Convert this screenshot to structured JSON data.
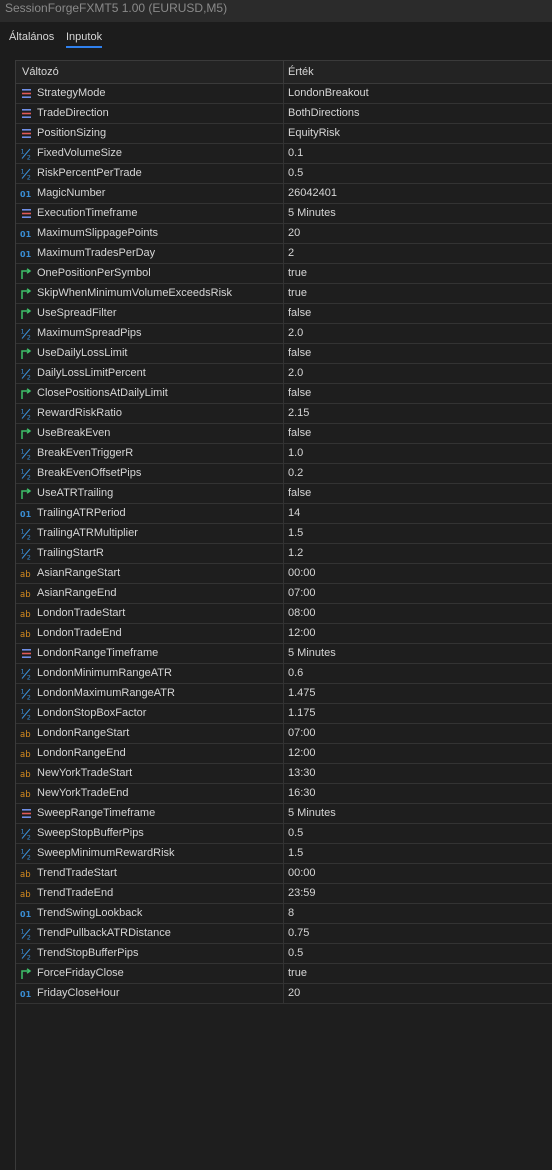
{
  "window": {
    "title": "SessionForgeFXMT5 1.00 (EURUSD,M5)"
  },
  "tabs": [
    {
      "label": "Általános"
    },
    {
      "label": "Inputok"
    }
  ],
  "table": {
    "headers": {
      "variable": "Változó",
      "value": "Érték"
    },
    "rows": [
      {
        "type": "enum",
        "icon": "enum-icon",
        "name": "StrategyMode",
        "value": "LondonBreakout"
      },
      {
        "type": "enum",
        "icon": "enum-icon",
        "name": "TradeDirection",
        "value": "BothDirections"
      },
      {
        "type": "enum",
        "icon": "enum-icon",
        "name": "PositionSizing",
        "value": "EquityRisk"
      },
      {
        "type": "double",
        "icon": "double-icon",
        "name": "FixedVolumeSize",
        "value": "0.1"
      },
      {
        "type": "double",
        "icon": "double-icon",
        "name": "RiskPercentPerTrade",
        "value": "0.5"
      },
      {
        "type": "int",
        "icon": "integer-icon",
        "name": "MagicNumber",
        "value": "26042401"
      },
      {
        "type": "enum",
        "icon": "enum-icon",
        "name": "ExecutionTimeframe",
        "value": "5 Minutes"
      },
      {
        "type": "int",
        "icon": "integer-icon",
        "name": "MaximumSlippagePoints",
        "value": "20"
      },
      {
        "type": "int",
        "icon": "integer-icon",
        "name": "MaximumTradesPerDay",
        "value": "2"
      },
      {
        "type": "bool",
        "icon": "bool-icon",
        "name": "OnePositionPerSymbol",
        "value": "true"
      },
      {
        "type": "bool",
        "icon": "bool-icon",
        "name": "SkipWhenMinimumVolumeExceedsRisk",
        "value": "true"
      },
      {
        "type": "bool",
        "icon": "bool-icon",
        "name": "UseSpreadFilter",
        "value": "false"
      },
      {
        "type": "double",
        "icon": "double-icon",
        "name": "MaximumSpreadPips",
        "value": "2.0"
      },
      {
        "type": "bool",
        "icon": "bool-icon",
        "name": "UseDailyLossLimit",
        "value": "false"
      },
      {
        "type": "double",
        "icon": "double-icon",
        "name": "DailyLossLimitPercent",
        "value": "2.0"
      },
      {
        "type": "bool",
        "icon": "bool-icon",
        "name": "ClosePositionsAtDailyLimit",
        "value": "false"
      },
      {
        "type": "double",
        "icon": "double-icon",
        "name": "RewardRiskRatio",
        "value": "2.15"
      },
      {
        "type": "bool",
        "icon": "bool-icon",
        "name": "UseBreakEven",
        "value": "false"
      },
      {
        "type": "double",
        "icon": "double-icon",
        "name": "BreakEvenTriggerR",
        "value": "1.0"
      },
      {
        "type": "double",
        "icon": "double-icon",
        "name": "BreakEvenOffsetPips",
        "value": "0.2"
      },
      {
        "type": "bool",
        "icon": "bool-icon",
        "name": "UseATRTrailing",
        "value": "false"
      },
      {
        "type": "int",
        "icon": "integer-icon",
        "name": "TrailingATRPeriod",
        "value": "14"
      },
      {
        "type": "double",
        "icon": "double-icon",
        "name": "TrailingATRMultiplier",
        "value": "1.5"
      },
      {
        "type": "double",
        "icon": "double-icon",
        "name": "TrailingStartR",
        "value": "1.2"
      },
      {
        "type": "string",
        "icon": "string-icon",
        "name": "AsianRangeStart",
        "value": "00:00"
      },
      {
        "type": "string",
        "icon": "string-icon",
        "name": "AsianRangeEnd",
        "value": "07:00"
      },
      {
        "type": "string",
        "icon": "string-icon",
        "name": "LondonTradeStart",
        "value": "08:00"
      },
      {
        "type": "string",
        "icon": "string-icon",
        "name": "LondonTradeEnd",
        "value": "12:00"
      },
      {
        "type": "enum",
        "icon": "enum-icon",
        "name": "LondonRangeTimeframe",
        "value": "5 Minutes"
      },
      {
        "type": "double",
        "icon": "double-icon",
        "name": "LondonMinimumRangeATR",
        "value": "0.6"
      },
      {
        "type": "double",
        "icon": "double-icon",
        "name": "LondonMaximumRangeATR",
        "value": "1.475"
      },
      {
        "type": "double",
        "icon": "double-icon",
        "name": "LondonStopBoxFactor",
        "value": "1.175"
      },
      {
        "type": "string",
        "icon": "string-icon",
        "name": "LondonRangeStart",
        "value": "07:00"
      },
      {
        "type": "string",
        "icon": "string-icon",
        "name": "LondonRangeEnd",
        "value": "12:00"
      },
      {
        "type": "string",
        "icon": "string-icon",
        "name": "NewYorkTradeStart",
        "value": "13:30"
      },
      {
        "type": "string",
        "icon": "string-icon",
        "name": "NewYorkTradeEnd",
        "value": "16:30"
      },
      {
        "type": "enum",
        "icon": "enum-icon",
        "name": "SweepRangeTimeframe",
        "value": "5 Minutes"
      },
      {
        "type": "double",
        "icon": "double-icon",
        "name": "SweepStopBufferPips",
        "value": "0.5"
      },
      {
        "type": "double",
        "icon": "double-icon",
        "name": "SweepMinimumRewardRisk",
        "value": "1.5"
      },
      {
        "type": "string",
        "icon": "string-icon",
        "name": "TrendTradeStart",
        "value": "00:00"
      },
      {
        "type": "string",
        "icon": "string-icon",
        "name": "TrendTradeEnd",
        "value": "23:59"
      },
      {
        "type": "int",
        "icon": "integer-icon",
        "name": "TrendSwingLookback",
        "value": "8"
      },
      {
        "type": "double",
        "icon": "double-icon",
        "name": "TrendPullbackATRDistance",
        "value": "0.75"
      },
      {
        "type": "double",
        "icon": "double-icon",
        "name": "TrendStopBufferPips",
        "value": "0.5"
      },
      {
        "type": "bool",
        "icon": "bool-icon",
        "name": "ForceFridayClose",
        "value": "true"
      },
      {
        "type": "int",
        "icon": "integer-icon",
        "name": "FridayCloseHour",
        "value": "20"
      }
    ]
  }
}
